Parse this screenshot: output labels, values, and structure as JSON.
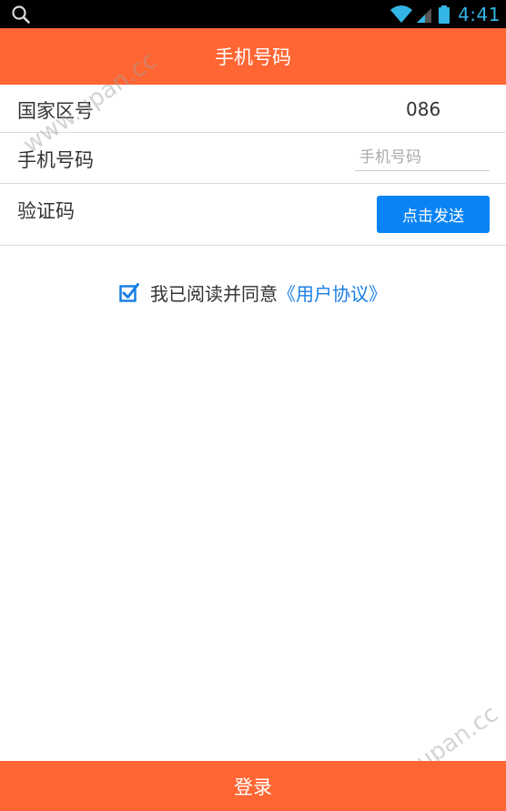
{
  "status_bar": {
    "time": "4:41",
    "icons": [
      "search-icon",
      "wifi-icon",
      "signal-icon",
      "battery-icon"
    ],
    "time_color": "#33b5e5"
  },
  "header": {
    "title": "手机号码",
    "color": "#ff6633"
  },
  "form": {
    "country_label": "国家区号",
    "country_code": "086",
    "phone_label": "手机号码",
    "phone_value": "",
    "phone_placeholder": "手机号码",
    "code_label": "验证码",
    "send_button": "点击发送",
    "send_button_color": "#0a84f5"
  },
  "agreement": {
    "checked": true,
    "text": "我已阅读并同意",
    "link": "《用户协议》",
    "link_color": "#1a7fe6"
  },
  "watermark": {
    "top": "www.upan.cc",
    "bottom": "www.upan.cc"
  },
  "footer": {
    "login_label": "登录"
  }
}
